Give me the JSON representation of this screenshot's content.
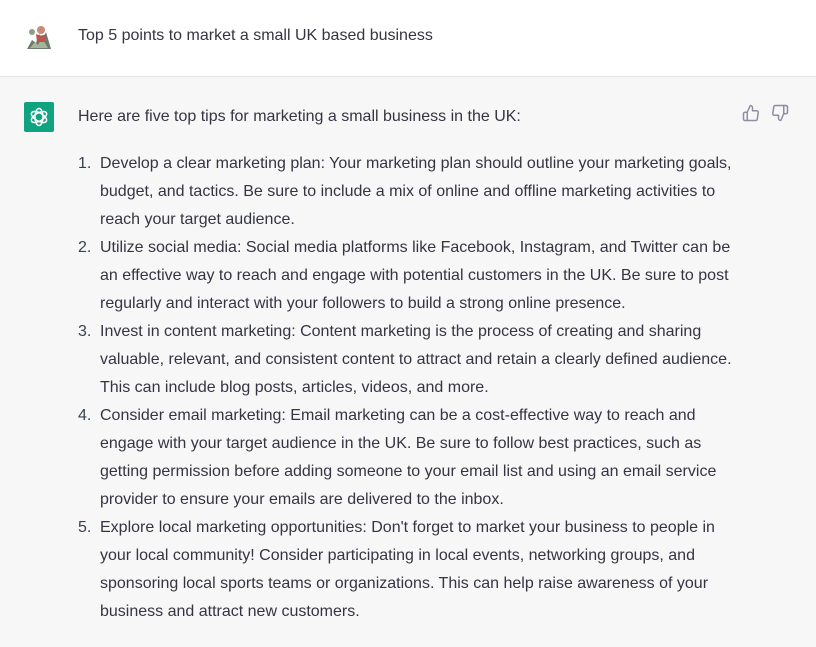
{
  "user": {
    "message": "Top 5 points to market a small UK based business"
  },
  "assistant": {
    "intro": "Here are five top tips for marketing a small business in the UK:",
    "tips": [
      {
        "number": "1.",
        "text": "Develop a clear marketing plan: Your marketing plan should outline your marketing goals, budget, and tactics. Be sure to include a mix of online and offline marketing activities to reach your target audience."
      },
      {
        "number": "2.",
        "text": "Utilize social media: Social media platforms like Facebook, Instagram, and Twitter can be an effective way to reach and engage with potential customers in the UK. Be sure to post regularly and interact with your followers to build a strong online presence."
      },
      {
        "number": "3.",
        "text": "Invest in content marketing: Content marketing is the process of creating and sharing valuable, relevant, and consistent content to attract and retain a clearly defined audience. This can include blog posts, articles, videos, and more."
      },
      {
        "number": "4.",
        "text": "Consider email marketing: Email marketing can be a cost-effective way to reach and engage with your target audience in the UK. Be sure to follow best practices, such as getting permission before adding someone to your email list and using an email service provider to ensure your emails are delivered to the inbox."
      },
      {
        "number": "5.",
        "text": "Explore local marketing opportunities: Don't forget to market your business to people in your local community! Consider participating in local events, networking groups, and sponsoring local sports teams or organizations. This can help raise awareness of your business and attract new customers."
      }
    ]
  },
  "icons": {
    "user_avatar": "user-avatar-image",
    "assistant_logo": "openai-logo-icon",
    "thumbs_up": "thumbs-up-icon",
    "thumbs_down": "thumbs-down-icon"
  },
  "colors": {
    "assistant_bg": "#f7f7f8",
    "logo_bg": "#10a37f",
    "text": "#343541"
  }
}
